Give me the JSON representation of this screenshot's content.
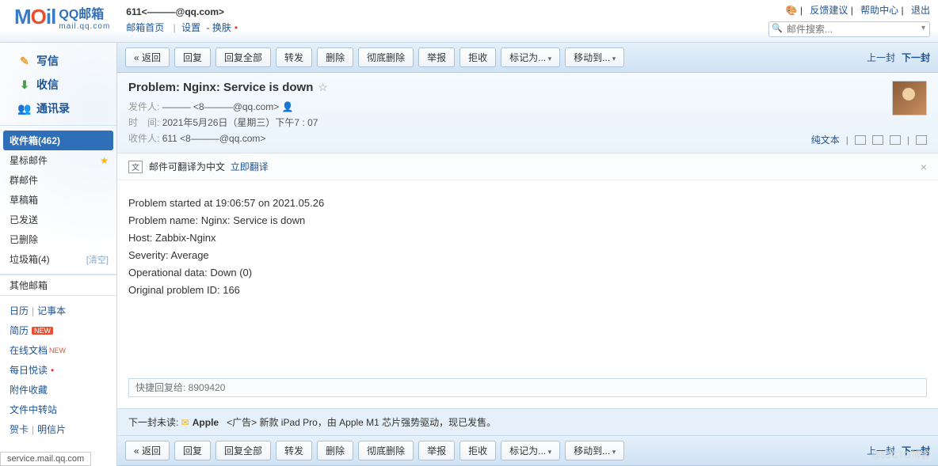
{
  "header": {
    "logo_text": "MOil",
    "logo_brand": "QQ邮箱",
    "logo_sub": "mail.qq.com",
    "user_display": "611<———@qq.com>",
    "links": {
      "home": "邮箱首页",
      "settings": "设置",
      "skin": "换肤"
    },
    "right": {
      "feedback": "反馈建议",
      "help": "帮助中心",
      "logout": "退出"
    },
    "search_placeholder": "邮件搜索..."
  },
  "sidebar": {
    "write": "写信",
    "receive": "收信",
    "contacts": "通讯录",
    "inbox": "收件箱(462)",
    "starred": "星标邮件",
    "group": "群邮件",
    "drafts": "草稿箱",
    "sent": "已发送",
    "deleted": "已删除",
    "spam": "垃圾箱(4)",
    "clear": "[清空]",
    "other": "其他邮箱",
    "calendar": "日历",
    "notes": "记事本",
    "resume": "简历",
    "docs": "在线文档",
    "daily": "每日悦读",
    "attach": "附件收藏",
    "transfer": "文件中转站",
    "card": "贺卡",
    "postcard": "明信片"
  },
  "toolbar": {
    "back": "« 返回",
    "reply": "回复",
    "reply_all": "回复全部",
    "forward": "转发",
    "delete": "删除",
    "delete_perm": "彻底删除",
    "report": "举报",
    "reject": "拒收",
    "mark_as": "标记为...",
    "move_to": "移动到...",
    "prev": "上一封",
    "next": "下一封"
  },
  "mail": {
    "subject": "Problem: Nginx: Service is down",
    "from_label": "发件人:",
    "from_value": "——— <8———@qq.com>",
    "time_label": "时　间:",
    "time_value": "2021年5月26日（星期三）下午7 : 07",
    "to_label": "收件人:",
    "to_value": "611 <8———@qq.com>",
    "plaintext": "纯文本",
    "translate_hint": "邮件可翻译为中文",
    "translate_now": "立即翻译",
    "body_lines": [
      "Problem started at 19:06:57 on 2021.05.26",
      "Problem name: Nginx: Service is down",
      "Host: Zabbix-Nginx",
      "Severity: Average",
      "Operational data: Down (0)",
      "Original problem ID: 166"
    ],
    "quick_reply_placeholder": "快捷回复给: 8909420",
    "next_unread_label": "下一封未读:",
    "next_sender": "Apple",
    "next_subject": "<广告> 新款 iPad Pro，由 Apple M1 芯片强势驱动，现已发售。"
  },
  "status_bar": "service.mail.qq.com",
  "watermark": "@51CTO博客"
}
